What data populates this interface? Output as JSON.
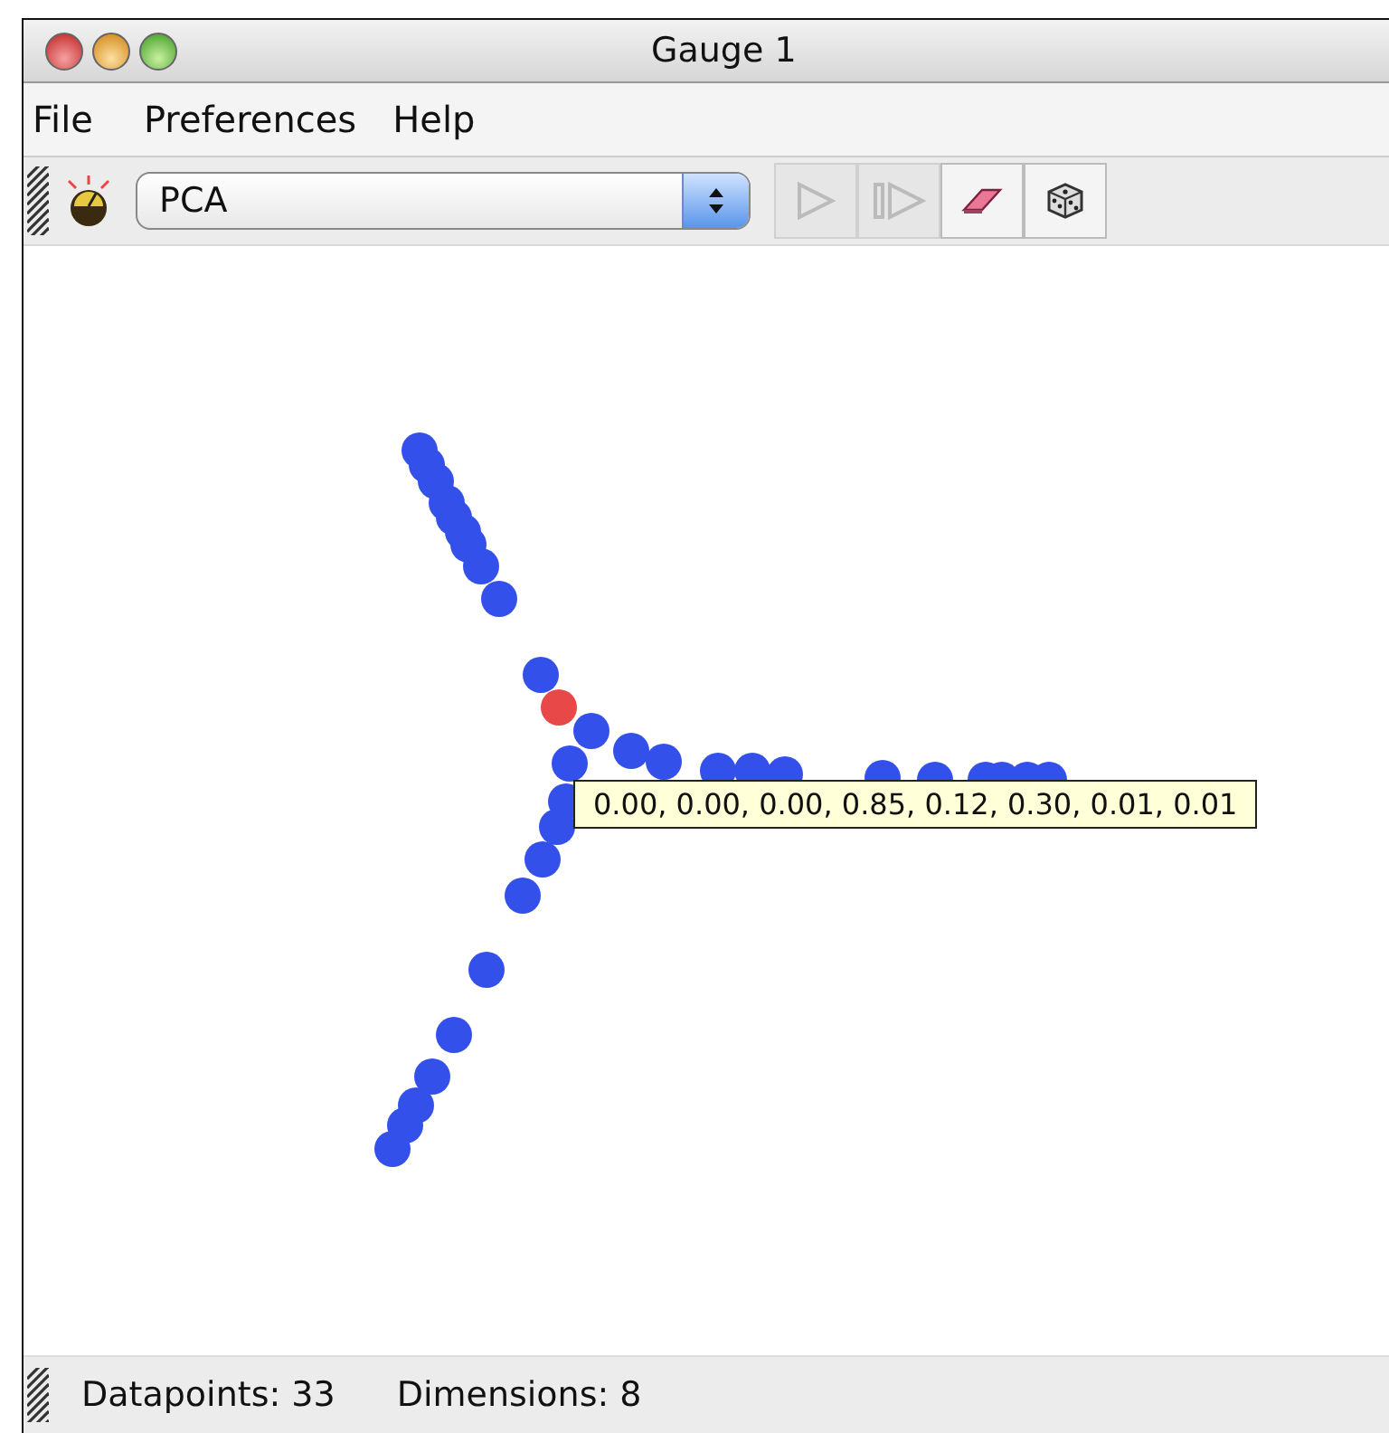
{
  "window": {
    "title": "Gauge 1"
  },
  "menu": [
    "File",
    "Preferences",
    "Help"
  ],
  "toolbar": {
    "dropdown": {
      "value": "PCA"
    },
    "buttons": [
      {
        "kind": "play",
        "disabled": true
      },
      {
        "kind": "step",
        "disabled": true
      },
      {
        "kind": "eraser",
        "disabled": false
      },
      {
        "kind": "dice",
        "disabled": false
      }
    ]
  },
  "plot": {
    "tooltip": "0.00, 0.00, 0.00, 0.85, 0.12, 0.30, 0.01, 0.01"
  },
  "status_bar": [
    "Datapoints: 33",
    "Dimensions: 8"
  ]
}
